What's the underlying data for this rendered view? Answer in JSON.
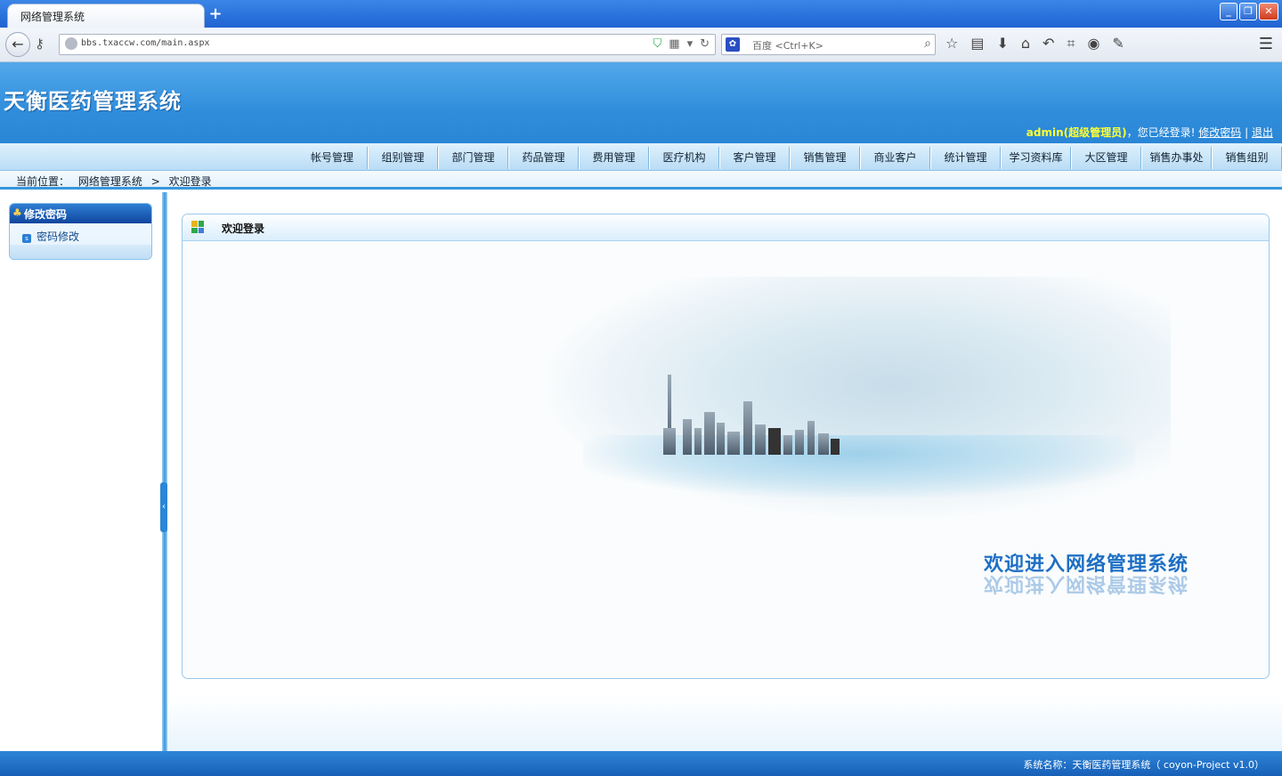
{
  "browser": {
    "tab_title": "网络管理系统",
    "new_tab": "+",
    "url": "bbs.txaccw.com/main.aspx",
    "search_engine": "百度",
    "search_placeholder": "百度 <Ctrl+K>",
    "window_buttons": [
      "_",
      "❐",
      "✕"
    ]
  },
  "app": {
    "title": "天衡医药管理系统",
    "user_name": "admin(超级管理员)",
    "logged_in_text": "，您已经登录!",
    "change_password_link": "修改密码",
    "separator": "|",
    "logout_link": "退出"
  },
  "nav": {
    "items": [
      "帐号管理",
      "组别管理",
      "部门管理",
      "药品管理",
      "费用管理",
      "医疗机构",
      "客户管理",
      "销售管理",
      "商业客户",
      "统计管理",
      "学习资料库",
      "大区管理",
      "销售办事处",
      "销售组别"
    ]
  },
  "breadcrumb": {
    "label": "当前位置：",
    "root": "网络管理系统",
    "arrow": ">",
    "current": "欢迎登录"
  },
  "sidebar": {
    "header": "修改密码",
    "items": [
      {
        "label": "密码修改"
      }
    ]
  },
  "panel": {
    "title": "欢迎登录",
    "banner": "欢迎进入网络管理系统"
  },
  "status_bar": {
    "text": "系统名称：天衡医药管理系统（ coyon-Project v1.0）"
  },
  "colors": {
    "header_blue": "#2f8edc",
    "user_yellow": "#ffff33",
    "banner_blue": "#1e6fc4"
  }
}
